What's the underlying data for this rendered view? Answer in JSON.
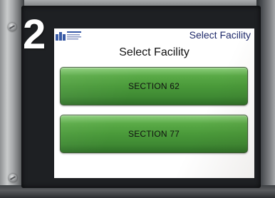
{
  "step_number": "2",
  "screen": {
    "header_title": "Select Facility",
    "title": "Select Facility",
    "buttons": [
      {
        "label": "SECTION 62"
      },
      {
        "label": "SECTION 77"
      }
    ]
  },
  "colors": {
    "button_green": "#4a9a3a",
    "header_text": "#1f2a6b",
    "logo_blue": "#2b4fa0"
  },
  "icons": {
    "logo": "company-logo-icon",
    "screw": "screw-icon"
  }
}
